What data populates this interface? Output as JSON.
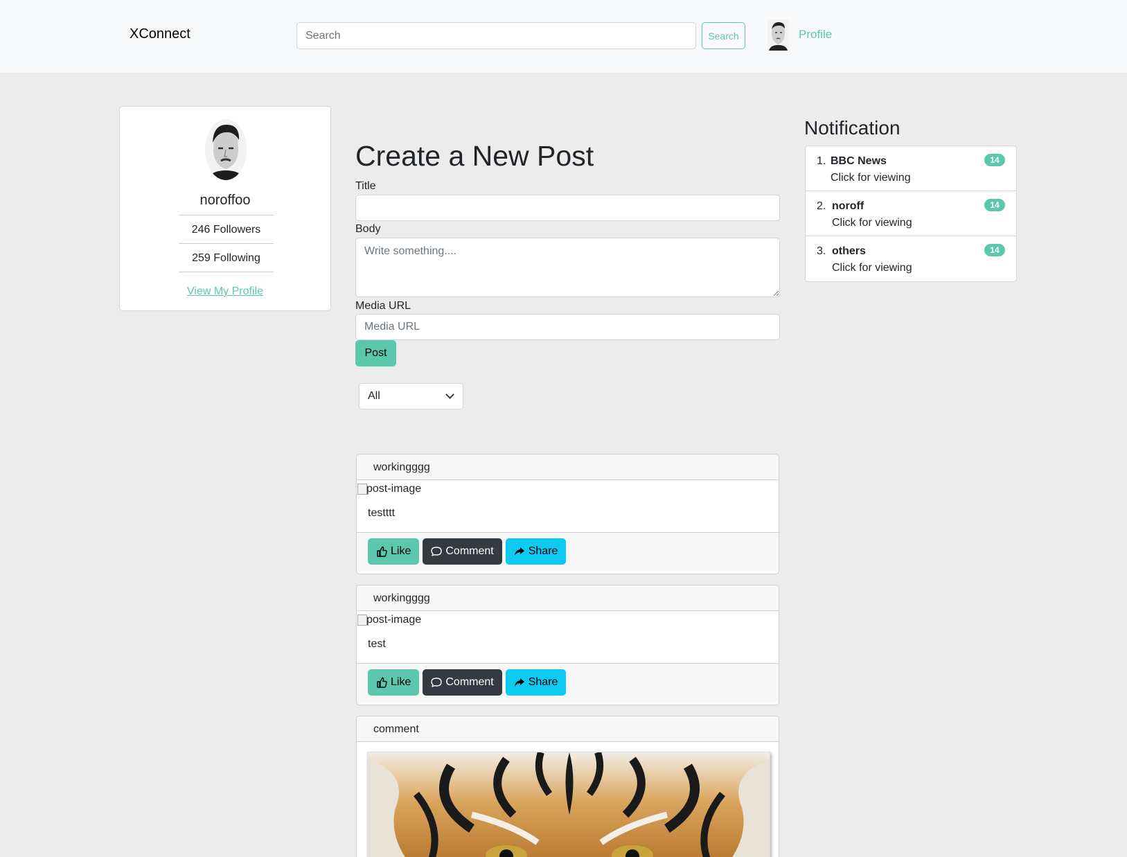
{
  "navbar": {
    "brand": "XConnect",
    "search_placeholder": "Search",
    "search_button": "Search",
    "profile_link": "Profile"
  },
  "profile_card": {
    "username": "noroffoo",
    "followers": "246 Followers",
    "following": "259 Following",
    "view_profile": "View My Profile"
  },
  "create_post": {
    "heading": "Create a New Post",
    "title_label": "Title",
    "title_value": "",
    "body_label": "Body",
    "body_placeholder": "Write something....",
    "media_label": "Media URL",
    "media_placeholder": "Media URL",
    "post_button": "Post"
  },
  "filter": {
    "selected": "All"
  },
  "posts": [
    {
      "author": "workingggg",
      "image_alt": "post-image",
      "body": "testttt",
      "like": "Like",
      "comment": "Comment",
      "share": "Share"
    },
    {
      "author": "workingggg",
      "image_alt": "post-image",
      "body": "test",
      "like": "Like",
      "comment": "Comment",
      "share": "Share"
    },
    {
      "author": "comment",
      "image": "tiger-face-photo"
    }
  ],
  "notifications": {
    "heading": "Notification",
    "items": [
      {
        "number": "1.",
        "title": "BBC News",
        "subtitle": "Click for viewing",
        "badge": "14"
      },
      {
        "number": "2.",
        "title": "noroff",
        "subtitle": "Click for viewing",
        "badge": "14"
      },
      {
        "number": "3.",
        "title": "others",
        "subtitle": "Click for viewing",
        "badge": "14"
      }
    ]
  },
  "colors": {
    "accent": "#5bc8ad",
    "dark_button": "#343a40",
    "share_button": "#0dcaf0",
    "page_bg": "#ececec",
    "navbar_bg": "#f8f9fa"
  }
}
